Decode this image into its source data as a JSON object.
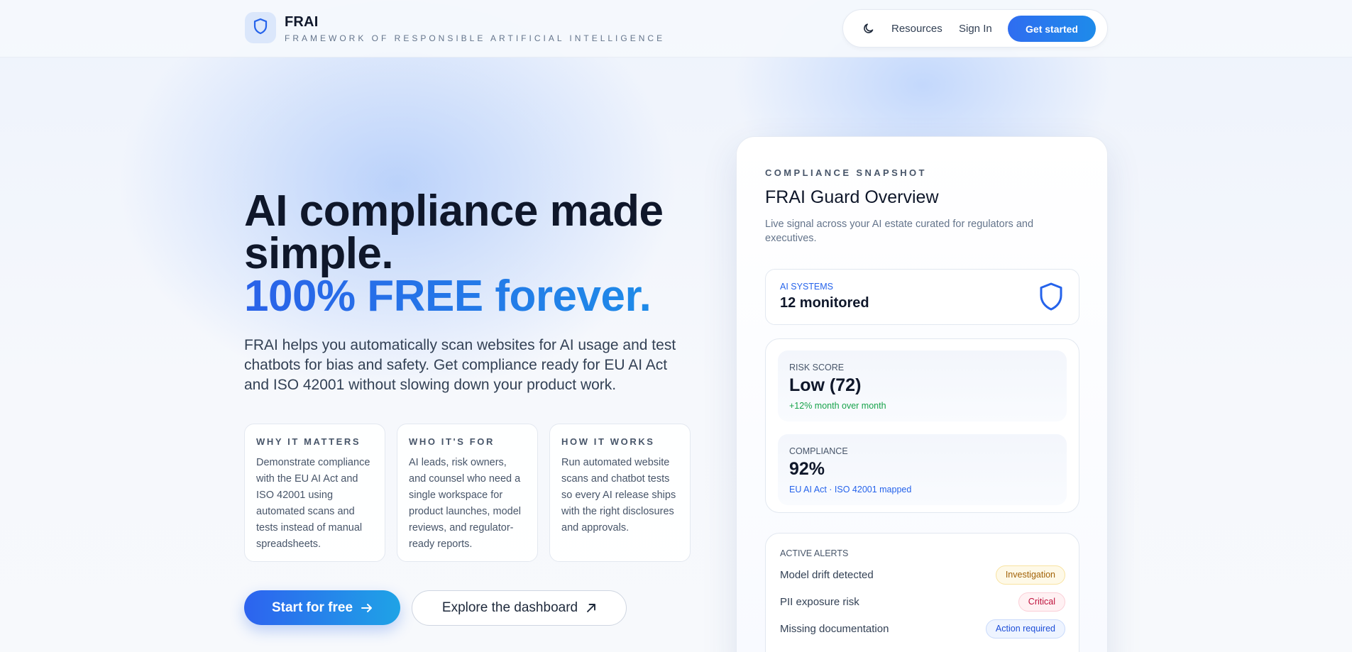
{
  "colors": {
    "accent": "#2563eb",
    "accent_gradient_end": "#1e8ce8",
    "text_primary": "#0f172a",
    "text_muted": "#64748b",
    "success": "#16a34a",
    "danger": "#be123c",
    "warning": "#a16207"
  },
  "header": {
    "brand_name": "FRAI",
    "brand_tagline": "FRAMEWORK OF RESPONSIBLE ARTIFICIAL INTELLIGENCE",
    "brand_icon": "shield-icon",
    "theme_toggle_icon": "moon-icon",
    "nav_resources": "Resources",
    "nav_sign_in": "Sign In",
    "cta_label": "Get started"
  },
  "hero": {
    "title_line1": "AI compliance made",
    "title_line2": "simple.",
    "title_line3": "100% FREE forever.",
    "description": "FRAI helps you automatically scan websites for AI usage and test chatbots for bias and safety. Get compliance ready for EU AI Act and ISO 42001 without slowing down your product work.",
    "cards": [
      {
        "kicker": "WHY IT MATTERS",
        "body": "Demonstrate compliance with the EU AI Act and ISO 42001 using automated scans and tests instead of manual spreadsheets."
      },
      {
        "kicker": "WHO IT'S FOR",
        "body": "AI leads, risk owners, and counsel who need a single workspace for product launches, model reviews, and regulator-ready reports."
      },
      {
        "kicker": "HOW IT WORKS",
        "body": "Run automated website scans and chatbot tests so every AI release ships with the right disclosures and approvals."
      }
    ],
    "primary_button": "Start for free",
    "primary_button_icon": "arrow-right-icon",
    "secondary_button": "Explore the dashboard",
    "secondary_button_icon": "arrow-up-right-icon"
  },
  "snapshot": {
    "kicker": "COMPLIANCE SNAPSHOT",
    "title": "FRAI Guard Overview",
    "description": "Live signal across your AI estate curated for regulators and executives.",
    "systems_label": "AI SYSTEMS",
    "systems_value": "12 monitored",
    "systems_icon": "shield-icon",
    "risk_label": "RISK SCORE",
    "risk_value": "Low (72)",
    "risk_note": "+12% month over month",
    "compliance_label": "COMPLIANCE",
    "compliance_value": "92%",
    "compliance_note": "EU AI Act · ISO 42001 mapped",
    "alerts_label": "ACTIVE ALERTS",
    "alerts": [
      {
        "name": "Model drift detected",
        "status": "Investigation"
      },
      {
        "name": "PII exposure risk",
        "status": "Critical"
      },
      {
        "name": "Missing documentation",
        "status": "Action required"
      }
    ]
  }
}
